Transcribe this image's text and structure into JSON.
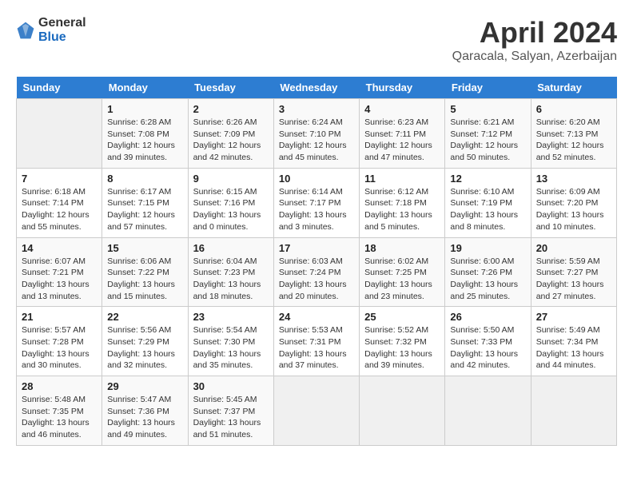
{
  "header": {
    "logo_general": "General",
    "logo_blue": "Blue",
    "month_title": "April 2024",
    "location": "Qaracala, Salyan, Azerbaijan"
  },
  "weekdays": [
    "Sunday",
    "Monday",
    "Tuesday",
    "Wednesday",
    "Thursday",
    "Friday",
    "Saturday"
  ],
  "weeks": [
    [
      {
        "day": "",
        "sunrise": "",
        "sunset": "",
        "daylight": ""
      },
      {
        "day": "1",
        "sunrise": "Sunrise: 6:28 AM",
        "sunset": "Sunset: 7:08 PM",
        "daylight": "Daylight: 12 hours and 39 minutes."
      },
      {
        "day": "2",
        "sunrise": "Sunrise: 6:26 AM",
        "sunset": "Sunset: 7:09 PM",
        "daylight": "Daylight: 12 hours and 42 minutes."
      },
      {
        "day": "3",
        "sunrise": "Sunrise: 6:24 AM",
        "sunset": "Sunset: 7:10 PM",
        "daylight": "Daylight: 12 hours and 45 minutes."
      },
      {
        "day": "4",
        "sunrise": "Sunrise: 6:23 AM",
        "sunset": "Sunset: 7:11 PM",
        "daylight": "Daylight: 12 hours and 47 minutes."
      },
      {
        "day": "5",
        "sunrise": "Sunrise: 6:21 AM",
        "sunset": "Sunset: 7:12 PM",
        "daylight": "Daylight: 12 hours and 50 minutes."
      },
      {
        "day": "6",
        "sunrise": "Sunrise: 6:20 AM",
        "sunset": "Sunset: 7:13 PM",
        "daylight": "Daylight: 12 hours and 52 minutes."
      }
    ],
    [
      {
        "day": "7",
        "sunrise": "Sunrise: 6:18 AM",
        "sunset": "Sunset: 7:14 PM",
        "daylight": "Daylight: 12 hours and 55 minutes."
      },
      {
        "day": "8",
        "sunrise": "Sunrise: 6:17 AM",
        "sunset": "Sunset: 7:15 PM",
        "daylight": "Daylight: 12 hours and 57 minutes."
      },
      {
        "day": "9",
        "sunrise": "Sunrise: 6:15 AM",
        "sunset": "Sunset: 7:16 PM",
        "daylight": "Daylight: 13 hours and 0 minutes."
      },
      {
        "day": "10",
        "sunrise": "Sunrise: 6:14 AM",
        "sunset": "Sunset: 7:17 PM",
        "daylight": "Daylight: 13 hours and 3 minutes."
      },
      {
        "day": "11",
        "sunrise": "Sunrise: 6:12 AM",
        "sunset": "Sunset: 7:18 PM",
        "daylight": "Daylight: 13 hours and 5 minutes."
      },
      {
        "day": "12",
        "sunrise": "Sunrise: 6:10 AM",
        "sunset": "Sunset: 7:19 PM",
        "daylight": "Daylight: 13 hours and 8 minutes."
      },
      {
        "day": "13",
        "sunrise": "Sunrise: 6:09 AM",
        "sunset": "Sunset: 7:20 PM",
        "daylight": "Daylight: 13 hours and 10 minutes."
      }
    ],
    [
      {
        "day": "14",
        "sunrise": "Sunrise: 6:07 AM",
        "sunset": "Sunset: 7:21 PM",
        "daylight": "Daylight: 13 hours and 13 minutes."
      },
      {
        "day": "15",
        "sunrise": "Sunrise: 6:06 AM",
        "sunset": "Sunset: 7:22 PM",
        "daylight": "Daylight: 13 hours and 15 minutes."
      },
      {
        "day": "16",
        "sunrise": "Sunrise: 6:04 AM",
        "sunset": "Sunset: 7:23 PM",
        "daylight": "Daylight: 13 hours and 18 minutes."
      },
      {
        "day": "17",
        "sunrise": "Sunrise: 6:03 AM",
        "sunset": "Sunset: 7:24 PM",
        "daylight": "Daylight: 13 hours and 20 minutes."
      },
      {
        "day": "18",
        "sunrise": "Sunrise: 6:02 AM",
        "sunset": "Sunset: 7:25 PM",
        "daylight": "Daylight: 13 hours and 23 minutes."
      },
      {
        "day": "19",
        "sunrise": "Sunrise: 6:00 AM",
        "sunset": "Sunset: 7:26 PM",
        "daylight": "Daylight: 13 hours and 25 minutes."
      },
      {
        "day": "20",
        "sunrise": "Sunrise: 5:59 AM",
        "sunset": "Sunset: 7:27 PM",
        "daylight": "Daylight: 13 hours and 27 minutes."
      }
    ],
    [
      {
        "day": "21",
        "sunrise": "Sunrise: 5:57 AM",
        "sunset": "Sunset: 7:28 PM",
        "daylight": "Daylight: 13 hours and 30 minutes."
      },
      {
        "day": "22",
        "sunrise": "Sunrise: 5:56 AM",
        "sunset": "Sunset: 7:29 PM",
        "daylight": "Daylight: 13 hours and 32 minutes."
      },
      {
        "day": "23",
        "sunrise": "Sunrise: 5:54 AM",
        "sunset": "Sunset: 7:30 PM",
        "daylight": "Daylight: 13 hours and 35 minutes."
      },
      {
        "day": "24",
        "sunrise": "Sunrise: 5:53 AM",
        "sunset": "Sunset: 7:31 PM",
        "daylight": "Daylight: 13 hours and 37 minutes."
      },
      {
        "day": "25",
        "sunrise": "Sunrise: 5:52 AM",
        "sunset": "Sunset: 7:32 PM",
        "daylight": "Daylight: 13 hours and 39 minutes."
      },
      {
        "day": "26",
        "sunrise": "Sunrise: 5:50 AM",
        "sunset": "Sunset: 7:33 PM",
        "daylight": "Daylight: 13 hours and 42 minutes."
      },
      {
        "day": "27",
        "sunrise": "Sunrise: 5:49 AM",
        "sunset": "Sunset: 7:34 PM",
        "daylight": "Daylight: 13 hours and 44 minutes."
      }
    ],
    [
      {
        "day": "28",
        "sunrise": "Sunrise: 5:48 AM",
        "sunset": "Sunset: 7:35 PM",
        "daylight": "Daylight: 13 hours and 46 minutes."
      },
      {
        "day": "29",
        "sunrise": "Sunrise: 5:47 AM",
        "sunset": "Sunset: 7:36 PM",
        "daylight": "Daylight: 13 hours and 49 minutes."
      },
      {
        "day": "30",
        "sunrise": "Sunrise: 5:45 AM",
        "sunset": "Sunset: 7:37 PM",
        "daylight": "Daylight: 13 hours and 51 minutes."
      },
      {
        "day": "",
        "sunrise": "",
        "sunset": "",
        "daylight": ""
      },
      {
        "day": "",
        "sunrise": "",
        "sunset": "",
        "daylight": ""
      },
      {
        "day": "",
        "sunrise": "",
        "sunset": "",
        "daylight": ""
      },
      {
        "day": "",
        "sunrise": "",
        "sunset": "",
        "daylight": ""
      }
    ]
  ]
}
